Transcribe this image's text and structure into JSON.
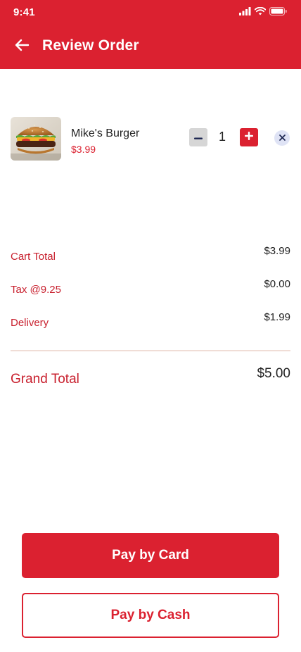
{
  "status_bar": {
    "time": "9:41",
    "icons": [
      "signal-icon",
      "wifi-icon",
      "battery-icon"
    ]
  },
  "header": {
    "title": "Review Order",
    "back_icon": "arrow-left-icon",
    "background_color": "#db2130"
  },
  "cart": {
    "items": [
      {
        "name": "Mike's Burger",
        "price": "$3.99",
        "quantity": "1",
        "image_icon": "burger-image",
        "minus_icon": "minus-icon",
        "plus_icon": "plus-icon",
        "remove_icon": "close-icon"
      }
    ]
  },
  "summary": {
    "cart_total_label": "Cart Total",
    "cart_total_value": "$3.99",
    "tax_label": "Tax @9.25",
    "tax_value": "$0.00",
    "delivery_label": "Delivery",
    "delivery_value": "$1.99",
    "grand_total_label": "Grand Total",
    "grand_total_value": "$5.00"
  },
  "actions": {
    "pay_card_label": "Pay by Card",
    "pay_cash_label": "Pay by Cash"
  },
  "colors": {
    "accent": "#db2130",
    "label_red": "#c8202e",
    "divider": "#f0ddd6",
    "minus_bg": "#d6d6d6",
    "remove_bg": "#dfe3f5"
  }
}
